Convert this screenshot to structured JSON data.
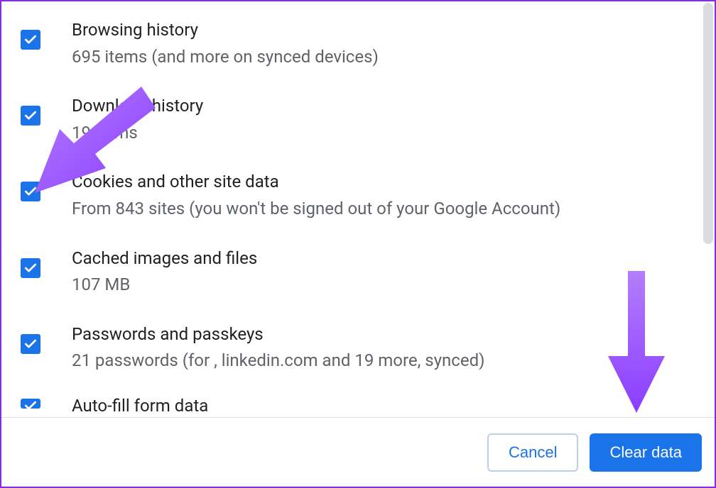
{
  "items": [
    {
      "title": "Browsing history",
      "sub": "695 items (and more on synced devices)",
      "checked": true
    },
    {
      "title": "Download history",
      "sub": "19   items",
      "checked": true
    },
    {
      "title": "Cookies and other site data",
      "sub": "From 843 sites (you won't be signed out of your Google Account)",
      "checked": true
    },
    {
      "title": "Cached images and files",
      "sub": "107 MB",
      "checked": true
    },
    {
      "title": "Passwords and passkeys",
      "sub": "21 passwords (for , linkedin.com and 19 more, synced)",
      "checked": true
    },
    {
      "title": "Auto-fill form data",
      "sub": "",
      "checked": true,
      "partial": true
    }
  ],
  "footer": {
    "cancel": "Cancel",
    "clear": "Clear data"
  },
  "colors": {
    "accent": "#1a73e8",
    "annotation": "#9b4dff"
  }
}
